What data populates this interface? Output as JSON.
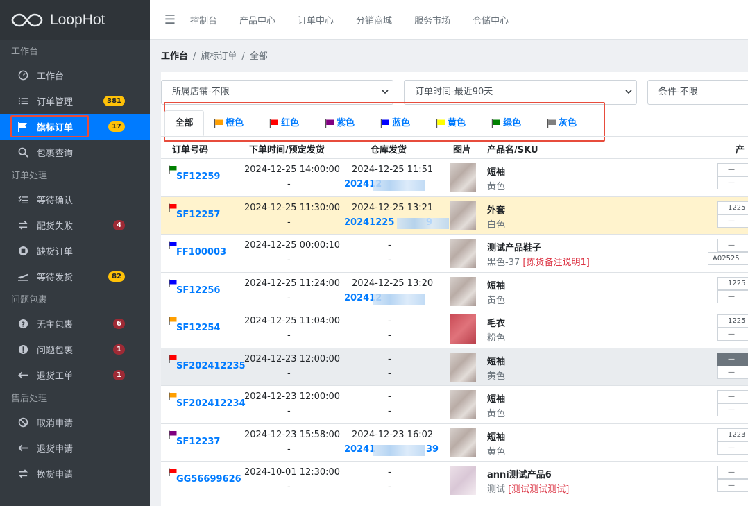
{
  "app": {
    "name": "LoopHot"
  },
  "sidebar": {
    "sections": [
      {
        "title": "工作台",
        "items": [
          {
            "label": "工作台",
            "icon": "dashboard-icon"
          },
          {
            "label": "订单管理",
            "icon": "list-icon",
            "badge": "381",
            "badge_color": "#ffc107"
          },
          {
            "label": "旗标订单",
            "icon": "flag-icon",
            "badge": "17",
            "badge_color": "#ffc107",
            "active": true
          },
          {
            "label": "包裹查询",
            "icon": "search-icon"
          }
        ]
      },
      {
        "title": "订单处理",
        "items": [
          {
            "label": "等待确认",
            "icon": "checklist-icon"
          },
          {
            "label": "配货失败",
            "icon": "exchange-icon",
            "badge": "4",
            "badge_color": "#dc3545"
          },
          {
            "label": "缺货订单",
            "icon": "stop-circle-icon"
          },
          {
            "label": "等待发货",
            "icon": "plane-icon",
            "badge": "82",
            "badge_color": "#ffc107"
          }
        ]
      },
      {
        "title": "问题包裹",
        "items": [
          {
            "label": "无主包裹",
            "icon": "question-circle-icon",
            "badge": "6",
            "badge_color": "#dc3545"
          },
          {
            "label": "问题包裹",
            "icon": "exclamation-circle-icon",
            "badge": "1",
            "badge_color": "#dc3545"
          },
          {
            "label": "退货工单",
            "icon": "arrow-left-icon",
            "badge": "1",
            "badge_color": "#dc3545"
          }
        ]
      },
      {
        "title": "售后处理",
        "items": [
          {
            "label": "取消申请",
            "icon": "ban-icon"
          },
          {
            "label": "退货申请",
            "icon": "arrow-left-icon"
          },
          {
            "label": "换货申请",
            "icon": "exchange-icon"
          }
        ]
      }
    ]
  },
  "topnav": {
    "items": [
      "控制台",
      "产品中心",
      "订单中心",
      "分销商城",
      "服务市场",
      "仓储中心"
    ]
  },
  "breadcrumb": {
    "root": "工作台",
    "mid": "旗标订单",
    "current": "全部"
  },
  "filters": {
    "store": "所属店铺-不限",
    "time": "订单时间-最近90天",
    "condition": "条件-不限"
  },
  "tabs": [
    {
      "label": "全部",
      "active": true
    },
    {
      "label": "橙色",
      "color": "#ff9f00"
    },
    {
      "label": "红色",
      "color": "#ff0000"
    },
    {
      "label": "紫色",
      "color": "#800080"
    },
    {
      "label": "蓝色",
      "color": "#0000ff"
    },
    {
      "label": "黄色",
      "color": "#ffff00"
    },
    {
      "label": "绿色",
      "color": "#008000"
    },
    {
      "label": "灰色",
      "color": "#808080"
    }
  ],
  "table": {
    "headers": [
      "订单号码",
      "下单时间/预定发货",
      "仓库发货",
      "图片",
      "产品名/SKU",
      "产"
    ],
    "rows": [
      {
        "flag": "#008000",
        "id": "SF12259",
        "time": "2024-12-25 14:00:00",
        "plan": "-",
        "wh_time": "2024-12-25 11:51",
        "wh_no": "202412",
        "name": "短袖",
        "sku": "黄色",
        "box1": "—",
        "box2": "—"
      },
      {
        "flag": "#ff0000",
        "id": "SF12257",
        "time": "2024-12-25 11:30:00",
        "plan": "-",
        "wh_time": "2024-12-25 13:21",
        "wh_no": "20241225",
        "wh_tail": "9",
        "name": "外套",
        "sku": "白色",
        "box1": "1225",
        "box2": "—",
        "highlight": "yellow"
      },
      {
        "flag": "#0000ff",
        "id": "FF100003",
        "time": "2024-12-25 00:00:10",
        "plan": "-",
        "wh_time": "-",
        "wh_no": "-",
        "name": "测试产品鞋子",
        "sku": "黑色-37 ",
        "note": "[拣货备注说明1]",
        "box1": "—",
        "box2": "A02525"
      },
      {
        "flag": "#0000ff",
        "id": "SF12256",
        "time": "2024-12-25 11:24:00",
        "plan": "-",
        "wh_time": "2024-12-25 13:20",
        "wh_no": "202412",
        "name": "短袖",
        "sku": "黄色",
        "box1": "1225",
        "box2": "—"
      },
      {
        "flag": "#ff9f00",
        "id": "SF12254",
        "time": "2024-12-25 11:04:00",
        "plan": "-",
        "wh_time": "-",
        "wh_no": "-",
        "name": "毛衣",
        "sku": "粉色",
        "box1": "1225",
        "box2": "—",
        "img": "red"
      },
      {
        "flag": "#ff0000",
        "id": "SF202412235",
        "time": "2024-12-23 12:00:00",
        "plan": "-",
        "wh_time": "-",
        "wh_no": "-",
        "name": "短袖",
        "sku": "黄色",
        "box1": "—",
        "box2": "—",
        "highlight": "gray"
      },
      {
        "flag": "#ff9f00",
        "id": "SF202412234",
        "time": "2024-12-23 12:00:00",
        "plan": "-",
        "wh_time": "-",
        "wh_no": "-",
        "name": "短袖",
        "sku": "黄色",
        "box1": "—",
        "box2": "—"
      },
      {
        "flag": "#800080",
        "id": "SF12237",
        "time": "2024-12-23 15:58:00",
        "plan": "-",
        "wh_time": "2024-12-23 16:02",
        "wh_no": "20241",
        "wh_tail": "39",
        "name": "短袖",
        "sku": "黄色",
        "box1": "1223",
        "box2": "—"
      },
      {
        "flag": "#ff0000",
        "id": "GG56699626",
        "time": "2024-10-01 12:30:00",
        "plan": "-",
        "wh_time": "-",
        "wh_no": "-",
        "name": "anni测试产品6",
        "sku": "测试 ",
        "note": "[测试测试测试]",
        "box1": "—",
        "box2": "—",
        "img": "pink"
      }
    ]
  }
}
